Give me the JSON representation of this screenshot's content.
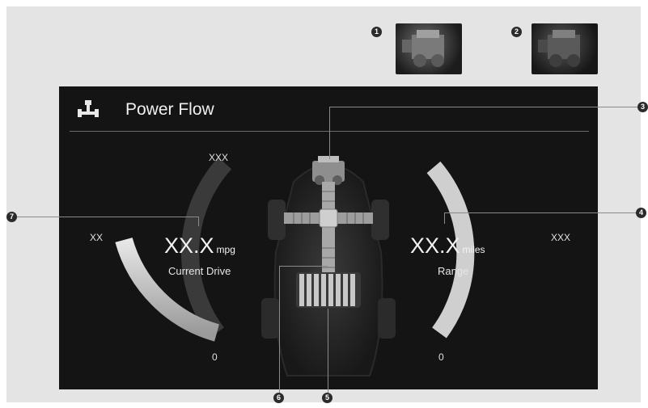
{
  "screen": {
    "title": "Power Flow",
    "title_icon": "drivetrain-icon"
  },
  "thumbnails": [
    {
      "callout": "1",
      "icon": "engine-image"
    },
    {
      "callout": "2",
      "icon": "engine-image"
    }
  ],
  "callouts": {
    "engine": "3",
    "range": "4",
    "battery": "5",
    "flow_path": "6",
    "current_drive": "7"
  },
  "left_gauge": {
    "value": "XX.X",
    "unit": "mpg",
    "label": "Current Drive",
    "max_label": "XXX",
    "mid_label": "XX",
    "min_label": "0"
  },
  "right_gauge": {
    "value": "XX.X",
    "unit": "miles",
    "label": "Range",
    "max_label": "XXX",
    "min_label": "0"
  },
  "colors": {
    "screen_bg": "#141414",
    "page_bg": "#e4e4e4",
    "gauge_track": "#3a3a3a",
    "gauge_fill": "#cfcfcf"
  }
}
